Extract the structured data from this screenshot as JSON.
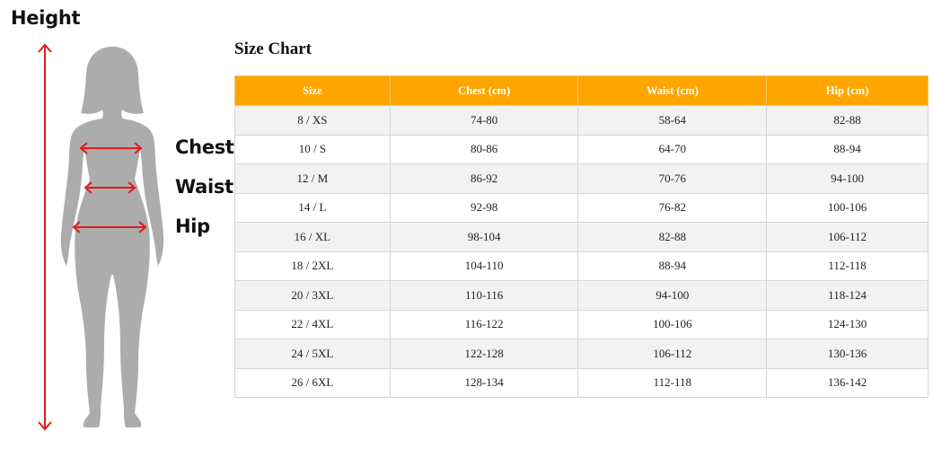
{
  "colors": {
    "header_bg": "#ffa500",
    "silhouette": "#acacac",
    "arrow": "#e41b1b"
  },
  "figure": {
    "height_label": "Height",
    "chest_label": "Chest",
    "waist_label": "Waist",
    "hip_label": "Hip"
  },
  "size_chart": {
    "title": "Size Chart",
    "headers": [
      "Size",
      "Chest (cm)",
      "Waist (cm)",
      "Hip (cm)"
    ],
    "rows": [
      [
        "8 / XS",
        "74-80",
        "58-64",
        "82-88"
      ],
      [
        "10 / S",
        "80-86",
        "64-70",
        "88-94"
      ],
      [
        "12 / M",
        "86-92",
        "70-76",
        "94-100"
      ],
      [
        "14 / L",
        "92-98",
        "76-82",
        "100-106"
      ],
      [
        "16 / XL",
        "98-104",
        "82-88",
        "106-112"
      ],
      [
        "18 / 2XL",
        "104-110",
        "88-94",
        "112-118"
      ],
      [
        "20 / 3XL",
        "110-116",
        "94-100",
        "118-124"
      ],
      [
        "22 / 4XL",
        "116-122",
        "100-106",
        "124-130"
      ],
      [
        "24 / 5XL",
        "122-128",
        "106-112",
        "130-136"
      ],
      [
        "26 / 6XL",
        "128-134",
        "112-118",
        "136-142"
      ]
    ]
  }
}
